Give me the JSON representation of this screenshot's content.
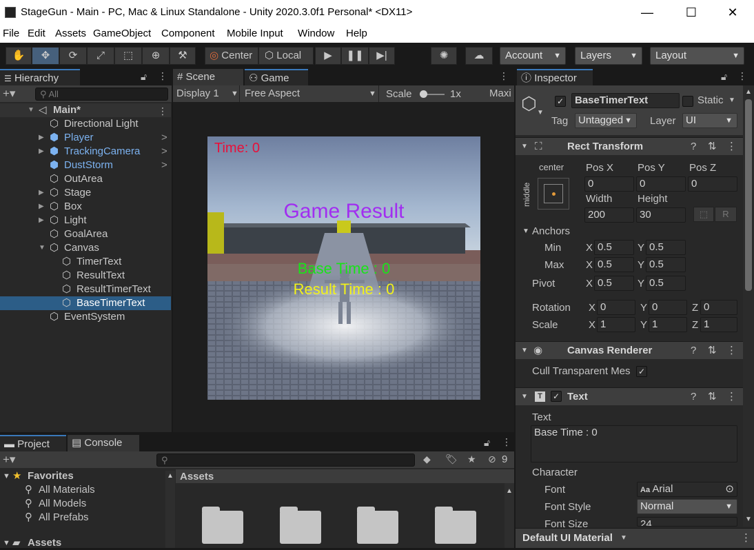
{
  "window": {
    "title": "StageGun - Main - PC, Mac & Linux Standalone - Unity 2020.3.0f1 Personal* <DX11>",
    "minimize": "—",
    "maximize": "☐",
    "close": "✕"
  },
  "menu": [
    "File",
    "Edit",
    "Assets",
    "GameObject",
    "Component",
    "Mobile Input",
    "Window",
    "Help"
  ],
  "toolbar": {
    "center_label": "Center",
    "local_label": "Local",
    "account_label": "Account",
    "layers_label": "Layers",
    "layout_label": "Layout"
  },
  "hierarchy": {
    "tab": "Hierarchy",
    "search_placeholder": "All",
    "scene": "Main*",
    "items": [
      {
        "label": "Directional Light",
        "depth": 1,
        "prefab": false,
        "expand": false,
        "more": false
      },
      {
        "label": "Player",
        "depth": 1,
        "prefab": true,
        "expand": true,
        "more": true
      },
      {
        "label": "TrackingCamera",
        "depth": 1,
        "prefab": true,
        "expand": true,
        "more": true
      },
      {
        "label": "DustStorm",
        "depth": 1,
        "prefab": true,
        "expand": false,
        "more": true
      },
      {
        "label": "OutArea",
        "depth": 1,
        "prefab": false,
        "expand": false,
        "more": false
      },
      {
        "label": "Stage",
        "depth": 1,
        "prefab": false,
        "expand": true,
        "more": false
      },
      {
        "label": "Box",
        "depth": 1,
        "prefab": false,
        "expand": true,
        "more": false
      },
      {
        "label": "Light",
        "depth": 1,
        "prefab": false,
        "expand": true,
        "more": false
      },
      {
        "label": "GoalArea",
        "depth": 1,
        "prefab": false,
        "expand": false,
        "more": false
      },
      {
        "label": "Canvas",
        "depth": 1,
        "prefab": false,
        "expand": true,
        "open": true,
        "more": false
      },
      {
        "label": "TimerText",
        "depth": 2,
        "prefab": false,
        "expand": false,
        "more": false
      },
      {
        "label": "ResultText",
        "depth": 2,
        "prefab": false,
        "expand": false,
        "more": false
      },
      {
        "label": "ResultTimerText",
        "depth": 2,
        "prefab": false,
        "expand": false,
        "more": false
      },
      {
        "label": "BaseTimerText",
        "depth": 2,
        "prefab": false,
        "expand": false,
        "more": false,
        "selected": true
      },
      {
        "label": "EventSystem",
        "depth": 1,
        "prefab": false,
        "expand": false,
        "more": false
      }
    ]
  },
  "scene_view": {
    "tab_scene": "Scene",
    "tab_game": "Game",
    "display": "Display 1",
    "aspect": "Free Aspect",
    "scale_label": "Scale",
    "scale_value": "1x",
    "maximize": "Maxi",
    "time_text": "Time: 0",
    "result_title": "Game Result",
    "base_time": "Base Time : 0",
    "result_time": "Result Time : 0"
  },
  "project": {
    "tab_project": "Project",
    "tab_console": "Console",
    "hidden_count": "9",
    "favorites": "Favorites",
    "fav_items": [
      "All Materials",
      "All Models",
      "All Prefabs"
    ],
    "assets_root": "Assets",
    "assets_header": "Assets"
  },
  "inspector": {
    "tab": "Inspector",
    "object_name": "BaseTimerText",
    "static_label": "Static",
    "tag_label": "Tag",
    "tag_value": "Untagged",
    "layer_label": "Layer",
    "layer_value": "UI",
    "rect_transform": {
      "title": "Rect Transform",
      "anchor_h": "center",
      "anchor_v": "middle",
      "pos_x_label": "Pos X",
      "pos_y_label": "Pos Y",
      "pos_z_label": "Pos Z",
      "pos_x": "0",
      "pos_y": "0",
      "pos_z": "0",
      "width_label": "Width",
      "height_label": "Height",
      "width": "200",
      "height": "30",
      "r_button": "R",
      "anchors_label": "Anchors",
      "min_label": "Min",
      "max_label": "Max",
      "x": "X",
      "y": "Y",
      "z": "Z",
      "min_x": "0.5",
      "min_y": "0.5",
      "max_x": "0.5",
      "max_y": "0.5",
      "pivot_label": "Pivot",
      "pivot_x": "0.5",
      "pivot_y": "0.5",
      "rotation_label": "Rotation",
      "rot_x": "0",
      "rot_y": "0",
      "rot_z": "0",
      "scale_label": "Scale",
      "scale_x": "1",
      "scale_y": "1",
      "scale_z": "1"
    },
    "canvas_renderer": {
      "title": "Canvas Renderer",
      "cull_label": "Cull Transparent Mes"
    },
    "text": {
      "title": "Text",
      "text_label": "Text",
      "text_value": "Base Time : 0",
      "character_label": "Character",
      "font_label": "Font",
      "font_value": "Arial",
      "font_prefix": "Aa",
      "font_style_label": "Font Style",
      "font_style_value": "Normal",
      "font_size_label": "Font Size",
      "font_size_value": "24"
    },
    "material_label": "Default UI Material"
  },
  "colors": {
    "selection": "#2c5d87",
    "prefab_blue": "#7cb2f0",
    "time_red": "#e8103a",
    "result_purple": "#a12ef0",
    "base_green": "#19e319",
    "result_yellow": "#f2f21a"
  }
}
